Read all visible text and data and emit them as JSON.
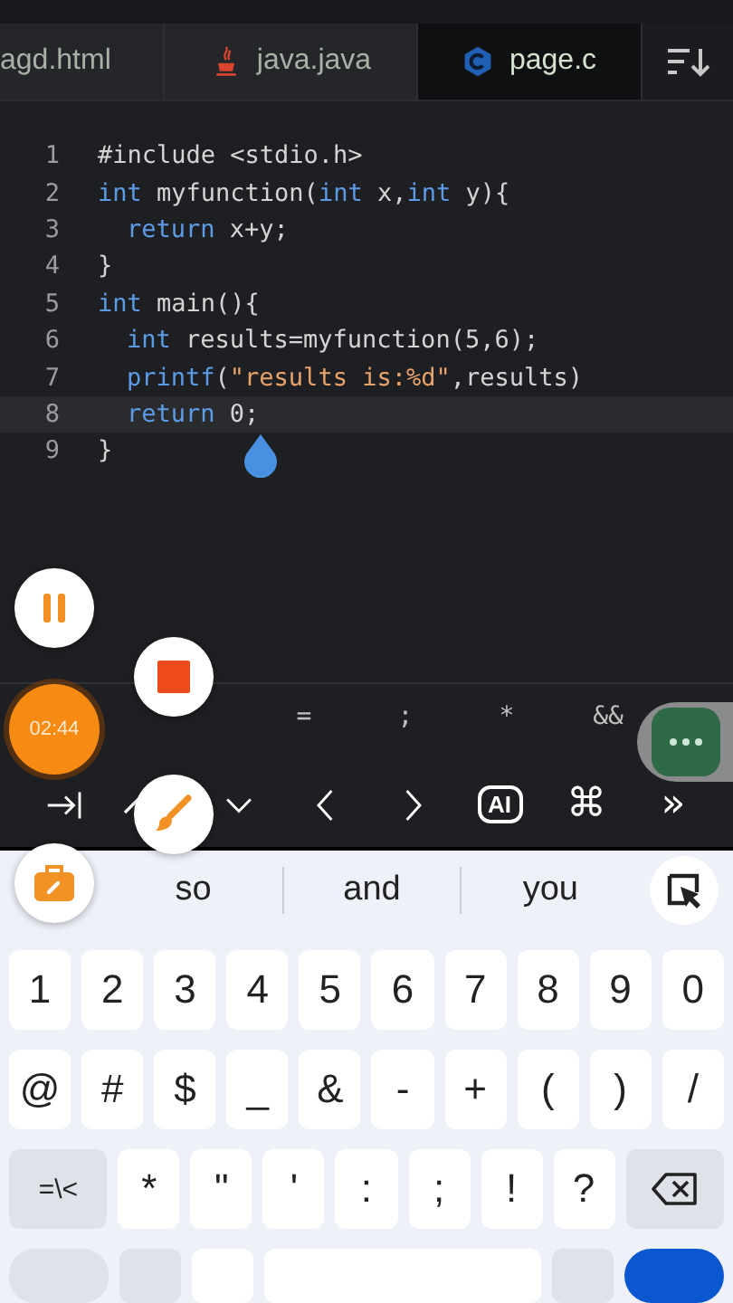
{
  "tabs": [
    {
      "label": "agd.html",
      "selected": false
    },
    {
      "label": "java.java",
      "selected": false
    },
    {
      "label": "page.c",
      "selected": true
    }
  ],
  "code": {
    "lines": [
      {
        "number": "1",
        "current": false,
        "indented": false,
        "tokens": [
          {
            "kind": "plain",
            "text": "#include <stdio.h>"
          }
        ]
      },
      {
        "number": "2",
        "current": false,
        "indented": false,
        "tokens": [
          {
            "kind": "keyword",
            "text": "int"
          },
          {
            "kind": "plain",
            "text": " myfunction("
          },
          {
            "kind": "keyword",
            "text": "int"
          },
          {
            "kind": "plain",
            "text": " x,"
          },
          {
            "kind": "keyword",
            "text": "int"
          },
          {
            "kind": "plain",
            "text": " y){"
          }
        ]
      },
      {
        "number": "3",
        "current": false,
        "indented": true,
        "tokens": [
          {
            "kind": "keyword",
            "text": "return"
          },
          {
            "kind": "plain",
            "text": " x+y;"
          }
        ]
      },
      {
        "number": "4",
        "current": false,
        "indented": false,
        "tokens": [
          {
            "kind": "plain",
            "text": "}"
          }
        ]
      },
      {
        "number": "5",
        "current": false,
        "indented": false,
        "tokens": [
          {
            "kind": "keyword",
            "text": "int"
          },
          {
            "kind": "plain",
            "text": " main(){"
          }
        ]
      },
      {
        "number": "6",
        "current": false,
        "indented": true,
        "tokens": [
          {
            "kind": "keyword",
            "text": "int"
          },
          {
            "kind": "plain",
            "text": " results=myfunction(5,6);"
          }
        ]
      },
      {
        "number": "7",
        "current": false,
        "indented": true,
        "tokens": [
          {
            "kind": "function",
            "text": "printf"
          },
          {
            "kind": "plain",
            "text": "("
          },
          {
            "kind": "string",
            "text": "\"results is:%d\""
          },
          {
            "kind": "plain",
            "text": ",results)"
          }
        ]
      },
      {
        "number": "8",
        "current": true,
        "indented": true,
        "tokens": [
          {
            "kind": "keyword",
            "text": "return"
          },
          {
            "kind": "plain",
            "text": " 0;"
          }
        ]
      },
      {
        "number": "9",
        "current": false,
        "indented": false,
        "tokens": [
          {
            "kind": "plain",
            "text": "}"
          }
        ]
      }
    ]
  },
  "recorder": {
    "time": "02:44"
  },
  "symbols": [
    "=",
    ";",
    "*",
    "&&"
  ],
  "tools": [
    {
      "kind": "tab"
    },
    {
      "kind": "up"
    },
    {
      "kind": "down"
    },
    {
      "kind": "left"
    },
    {
      "kind": "right"
    },
    {
      "kind": "ai",
      "text": "AI"
    },
    {
      "kind": "cmd",
      "text": "⌘"
    },
    {
      "kind": "more",
      "text": "»"
    }
  ],
  "suggestions": [
    "so",
    "and",
    "you"
  ],
  "keyboard": {
    "rows": [
      [
        {
          "text": "1"
        },
        {
          "text": "2"
        },
        {
          "text": "3"
        },
        {
          "text": "4"
        },
        {
          "text": "5"
        },
        {
          "text": "6"
        },
        {
          "text": "7"
        },
        {
          "text": "8"
        },
        {
          "text": "9"
        },
        {
          "text": "0"
        }
      ],
      [
        {
          "text": "@"
        },
        {
          "text": "#"
        },
        {
          "text": "$"
        },
        {
          "text": "_"
        },
        {
          "text": "&"
        },
        {
          "text": "-"
        },
        {
          "text": "+"
        },
        {
          "text": "("
        },
        {
          "text": ")"
        },
        {
          "text": "/"
        }
      ],
      [
        {
          "text": "=\\<",
          "kind": "function"
        },
        {
          "text": "*"
        },
        {
          "text": "\""
        },
        {
          "text": "'"
        },
        {
          "text": ":"
        },
        {
          "text": ";"
        },
        {
          "text": "!"
        },
        {
          "text": "?"
        },
        {
          "kind": "backspace"
        }
      ]
    ]
  }
}
